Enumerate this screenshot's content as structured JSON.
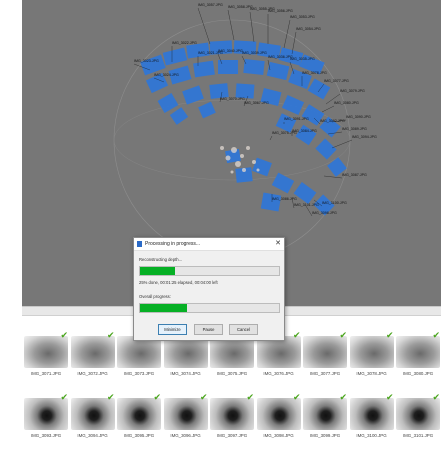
{
  "viewport": {
    "camera_labels": [
      "IMG_3057.JPG",
      "IMG_3058.JPG",
      "IMG_3055.JPG",
      "IMG_3056.JPG",
      "IMG_3053.JPG",
      "IMG_3054.JPG",
      "IMG_3022.JPG",
      "IMG_3021.JPG",
      "IMG_3040.JPG",
      "IMG_3039.JPG",
      "IMG_3036.JPG",
      "IMG_3035.JPG",
      "IMG_3023.JPG",
      "IMG_3024.JPG",
      "IMG_3070.JPG",
      "IMG_3067.JPG",
      "IMG_3078.JPG",
      "IMG_3077.JPG",
      "IMG_3079.JPG",
      "IMG_3080.JPG",
      "IMG_3090.JPG",
      "IMG_3089.JPG",
      "IMG_3094.JPG",
      "IMG_3092.JPG",
      "IMG_3091.JPG",
      "IMG_3084.JPG",
      "IMG_3075.JPG",
      "IMG_3087.JPG",
      "IMG_3086.JPG",
      "IMG_3101.JPG",
      "IMG_3100.JPG",
      "IMG_3098.JPG"
    ]
  },
  "dialog": {
    "title": "Processing in progress...",
    "close_glyph": "✕",
    "task_label": "Reconstructing depth...",
    "task_progress": 0.25,
    "status_text": "25% done, 00:01:25 elapsed, 00:04:00 left",
    "overall_label": "Overall progress:",
    "overall_progress": 0.34,
    "buttons": {
      "minimize": "Minimize",
      "pause": "Pause",
      "cancel": "Cancel"
    }
  },
  "gallery": {
    "check_glyph": "✔",
    "row1": [
      "IMG_3071.JPG",
      "IMG_3072.JPG",
      "IMG_3073.JPG",
      "IMG_3074.JPG",
      "IMG_3075.JPG",
      "IMG_3076.JPG",
      "IMG_3077.JPG",
      "IMG_3078.JPG",
      "IMG_3080.JPG"
    ],
    "row2": [
      "IMG_3093.JPG",
      "IMG_3094.JPG",
      "IMG_3095.JPG",
      "IMG_3096.JPG",
      "IMG_3097.JPG",
      "IMG_3098.JPG",
      "IMG_3099.JPG",
      "IMG_3100.JPG",
      "IMG_3101.JPG"
    ]
  },
  "colors": {
    "camera_blue": "#2f76d8",
    "progress_green": "#06b025",
    "check_green": "#4aa51d",
    "viewport_bg": "#777777"
  }
}
